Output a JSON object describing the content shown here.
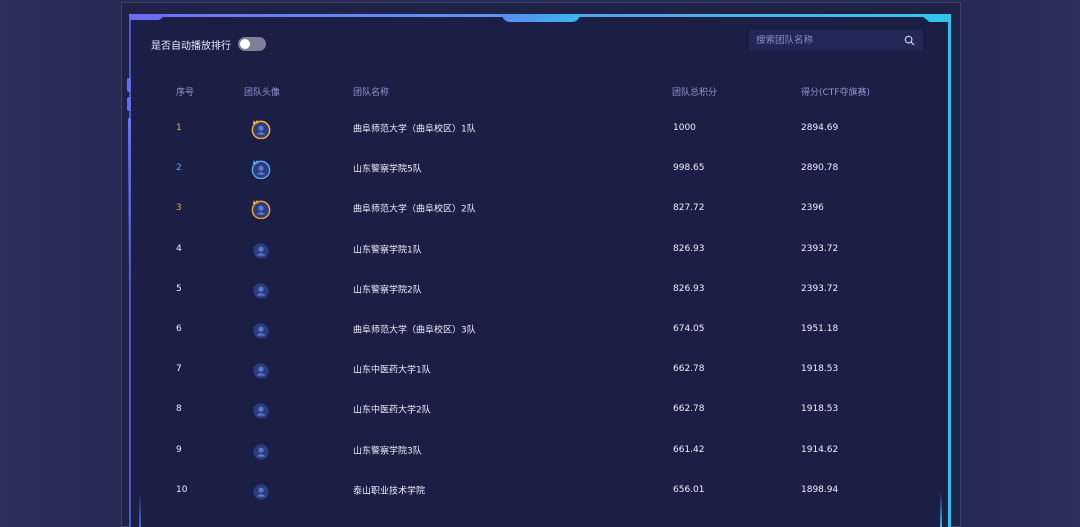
{
  "controls": {
    "autoplay_label": "是否自动播放排行",
    "autoplay_on": false,
    "search_placeholder": "搜索团队名称",
    "search_value": ""
  },
  "table": {
    "headers": {
      "rank": "序号",
      "avatar": "团队头像",
      "name": "团队名称",
      "total": "团队总积分",
      "score": "得分(CTF夺旗赛)"
    },
    "rows": [
      {
        "rank": "1",
        "name": "曲阜师范大学（曲阜校区）1队",
        "total": "1000",
        "score": "2894.69",
        "medal": "gold"
      },
      {
        "rank": "2",
        "name": "山东警察学院5队",
        "total": "998.65",
        "score": "2890.78",
        "medal": "silver"
      },
      {
        "rank": "3",
        "name": "曲阜师范大学（曲阜校区）2队",
        "total": "827.72",
        "score": "2396",
        "medal": "bronze"
      },
      {
        "rank": "4",
        "name": "山东警察学院1队",
        "total": "826.93",
        "score": "2393.72",
        "medal": "none"
      },
      {
        "rank": "5",
        "name": "山东警察学院2队",
        "total": "826.93",
        "score": "2393.72",
        "medal": "none"
      },
      {
        "rank": "6",
        "name": "曲阜师范大学（曲阜校区）3队",
        "total": "674.05",
        "score": "1951.18",
        "medal": "none"
      },
      {
        "rank": "7",
        "name": "山东中医药大学1队",
        "total": "662.78",
        "score": "1918.53",
        "medal": "none"
      },
      {
        "rank": "8",
        "name": "山东中医药大学2队",
        "total": "662.78",
        "score": "1918.53",
        "medal": "none"
      },
      {
        "rank": "9",
        "name": "山东警察学院3队",
        "total": "661.42",
        "score": "1914.62",
        "medal": "none"
      },
      {
        "rank": "10",
        "name": "泰山职业技术学院",
        "total": "656.01",
        "score": "1898.94",
        "medal": "none"
      }
    ]
  },
  "colors": {
    "gold": "#f2b33d",
    "silver": "#5fa7f5",
    "bronze": "#f0a040",
    "avatar_bg": "#2b3d7e",
    "avatar_fg": "#5c79c9"
  }
}
